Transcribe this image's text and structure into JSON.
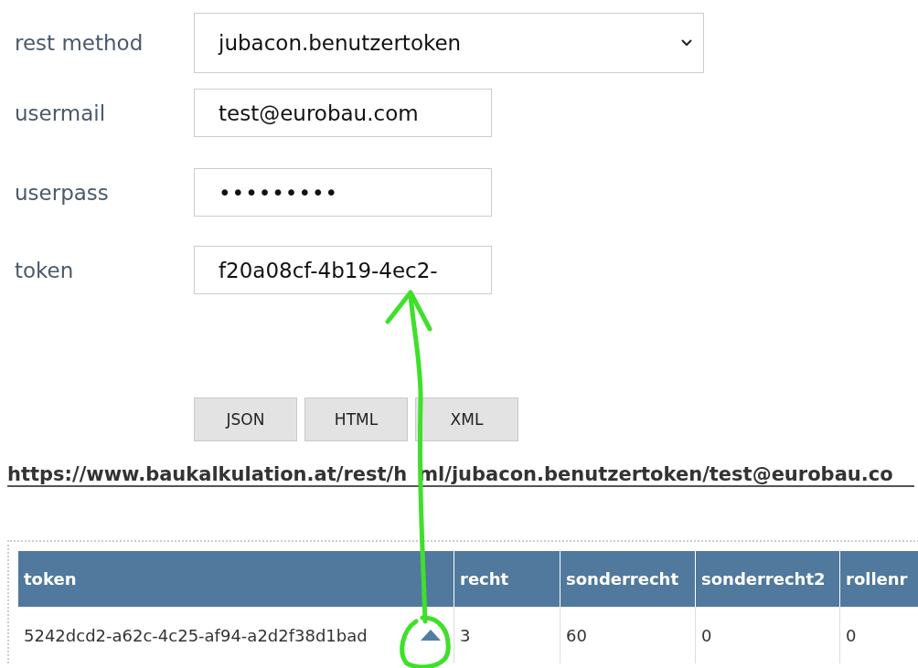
{
  "form": {
    "fields": [
      {
        "kind": "select",
        "label": "rest method",
        "value": "jubacon.benutzertoken"
      },
      {
        "kind": "text",
        "label": "usermail",
        "value": "test@eurobau.com"
      },
      {
        "kind": "password",
        "label": "userpass",
        "value": "•••••••••"
      },
      {
        "kind": "text",
        "label": "token",
        "value": "f20a08cf-4b19-4ec2-"
      }
    ],
    "buttons": [
      "JSON",
      "HTML",
      "XML"
    ]
  },
  "link": [
    "https://www.baukalkulation.at/rest/h",
    "ml/jubacon.benutzertoken/test@eurobau.co"
  ],
  "table": {
    "columns": [
      "token",
      "recht",
      "sonderrecht",
      "sonderrecht2",
      "rollenr"
    ],
    "rows": [
      [
        "5242dcd2-a62c-4c25-af94-a2d2f38d1bad",
        "3",
        "60",
        "0",
        "0"
      ]
    ]
  }
}
